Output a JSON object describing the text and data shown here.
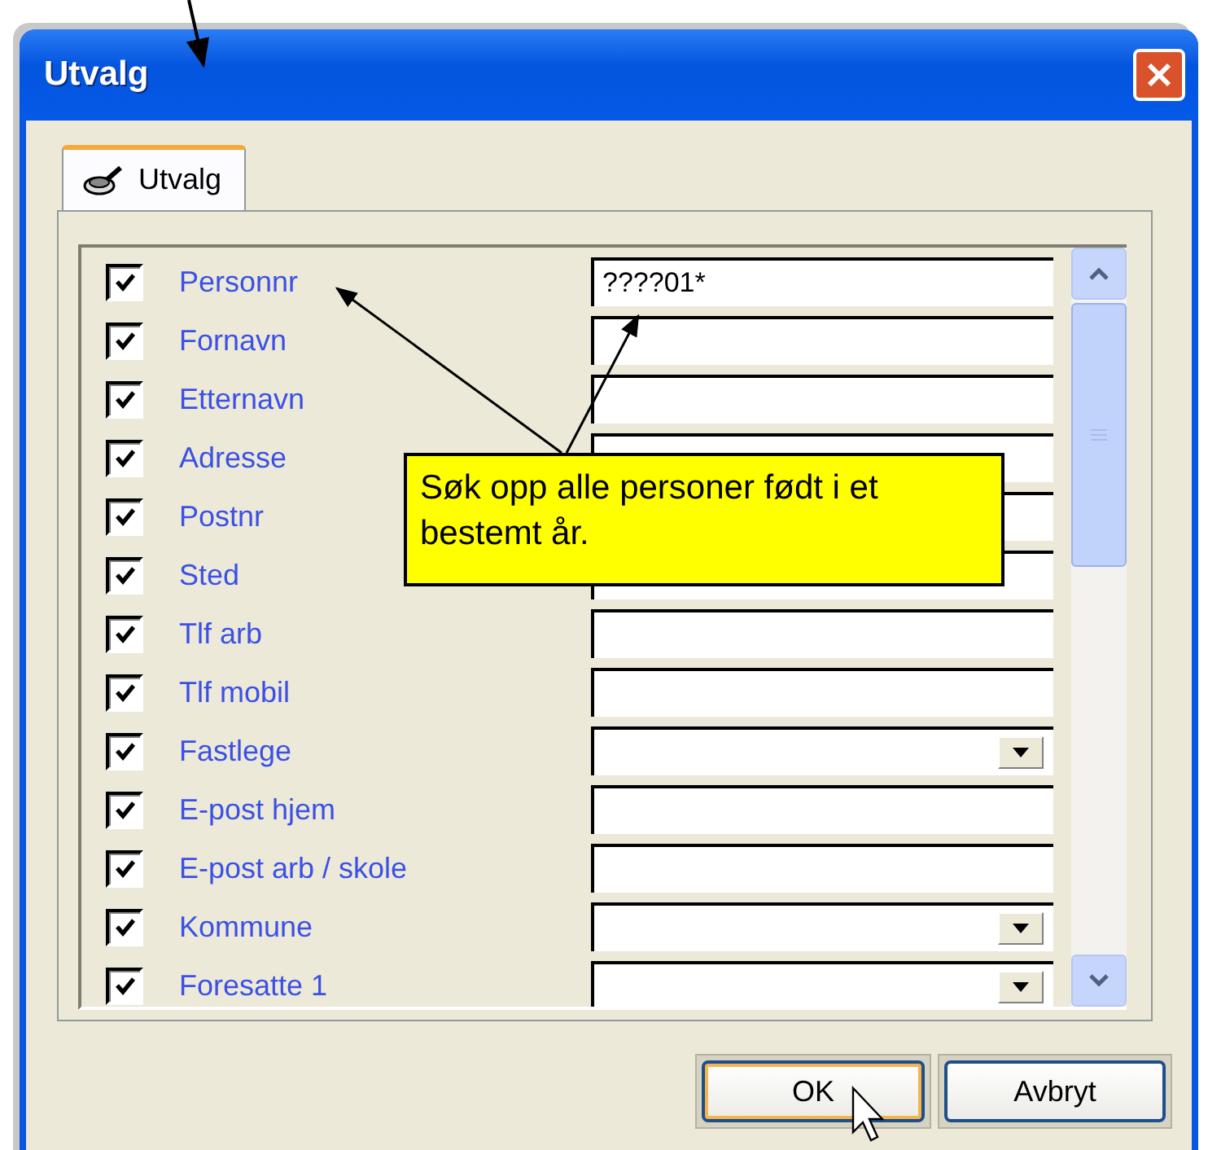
{
  "window": {
    "title": "Utvalg"
  },
  "tabs": [
    {
      "label": "Utvalg",
      "selected": true
    }
  ],
  "fields": [
    {
      "label": "Personnr",
      "checked": true,
      "kind": "text",
      "value": "????01*"
    },
    {
      "label": "Fornavn",
      "checked": true,
      "kind": "text"
    },
    {
      "label": "Etternavn",
      "checked": true,
      "kind": "text"
    },
    {
      "label": "Adresse",
      "checked": true,
      "kind": "text"
    },
    {
      "label": "Postnr",
      "checked": true,
      "kind": "text"
    },
    {
      "label": "Sted",
      "checked": true,
      "kind": "text"
    },
    {
      "label": "Tlf arb",
      "checked": true,
      "kind": "text"
    },
    {
      "label": "Tlf mobil",
      "checked": true,
      "kind": "text"
    },
    {
      "label": "Fastlege",
      "checked": true,
      "kind": "dropdown"
    },
    {
      "label": "E-post hjem",
      "checked": true,
      "kind": "text"
    },
    {
      "label": "E-post arb / skole",
      "checked": true,
      "kind": "text"
    },
    {
      "label": "Kommune",
      "checked": true,
      "kind": "dropdown"
    },
    {
      "label": "Foresatte 1",
      "checked": true,
      "kind": "dropdown"
    }
  ],
  "callout": {
    "text": "Søk opp alle personer født i et bestemt år."
  },
  "buttons": [
    {
      "label": "OK",
      "default": true
    },
    {
      "label": "Avbryt",
      "default": false
    }
  ]
}
